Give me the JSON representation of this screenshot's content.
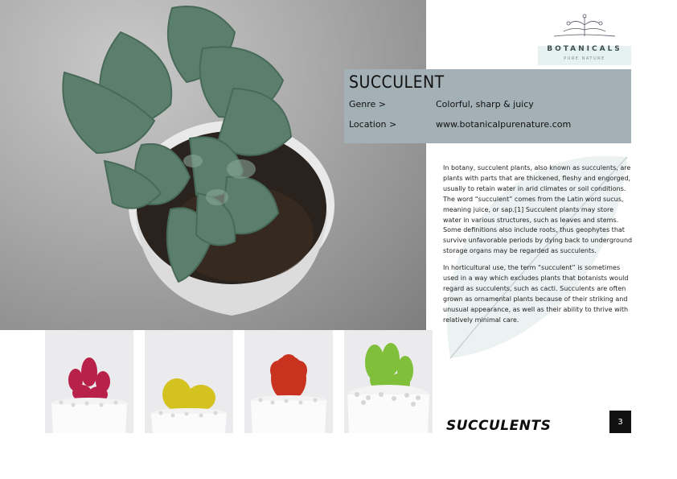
{
  "logo": {
    "name": "BOTANICALS",
    "tagline": "PURE NATURE"
  },
  "info": {
    "title": "SUCCULENT",
    "rows": [
      {
        "label": "Genre >",
        "value": "Colorful, sharp & juicy"
      },
      {
        "label": "Location >",
        "value": "www.botanicalpurenature.com"
      }
    ]
  },
  "body": {
    "paragraphs": [
      "In botany, succulent plants, also known as succulents, are plants with parts that are thickened, fleshy and engorged, usually to retain water in arid climates or soil conditions. The word “succulent” comes from the Latin word sucus, meaning juice, or sap.[1] Succulent plants may store water in various structures, such as leaves and stems. Some definitions also include roots, thus geophytes that survive unfavorable periods by dying back to underground storage organs may be regarded as succulents.",
      "In horticultural use, the term “succulent” is sometimes used in a way which excludes plants that botanists would regard as succulents, such as cacti. Succulents are often grown as ornamental plants because of their striking and unusual appearance, as well as their ability to thrive with relatively minimal care."
    ]
  },
  "thumbnails": [
    {
      "color": "#b8224a",
      "icon": "pink-cactus-photo"
    },
    {
      "color": "#d4c21e",
      "icon": "yellow-cactus-photo"
    },
    {
      "color": "#c8321e",
      "icon": "red-cactus-photo"
    },
    {
      "color": "#7fbf3a",
      "icon": "green-cactus-photo"
    }
  ],
  "caption": "SUCCULENTS",
  "page_number": "3",
  "colors": {
    "panel": "#a3b1b6",
    "logo_bg": "#e6f1f1",
    "page_box": "#111111"
  }
}
